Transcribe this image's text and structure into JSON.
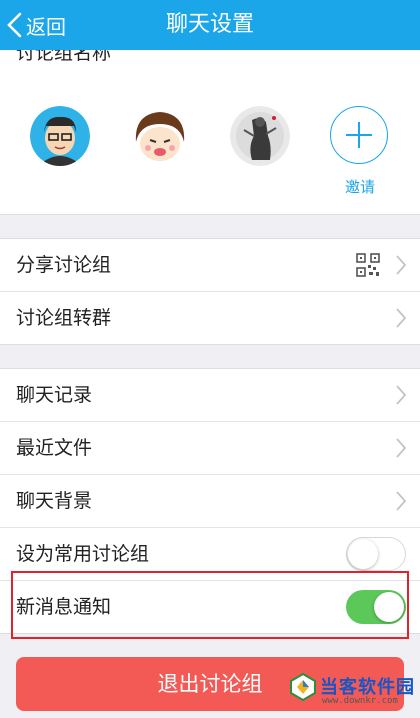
{
  "header": {
    "back_label": "返回",
    "title": "聊天设置"
  },
  "top_row": {
    "label": "讨论组名称"
  },
  "members": {
    "invite_label": "邀请"
  },
  "group1": [
    {
      "label": "分享讨论组"
    },
    {
      "label": "讨论组转群"
    }
  ],
  "group2": [
    {
      "label": "聊天记录"
    },
    {
      "label": "最近文件"
    },
    {
      "label": "聊天背景"
    }
  ],
  "settings": {
    "common_group": {
      "label": "设为常用讨论组",
      "enabled": false
    },
    "new_message": {
      "label": "新消息通知",
      "enabled": true
    }
  },
  "exit_button": "退出讨论组",
  "watermark": {
    "brand": "当客软件园",
    "url": "www.downkr.com"
  },
  "colors": {
    "header": "#1aa6e9",
    "toggle_on": "#5cc85a",
    "exit": "#f45a55",
    "highlight": "#e0232a"
  }
}
